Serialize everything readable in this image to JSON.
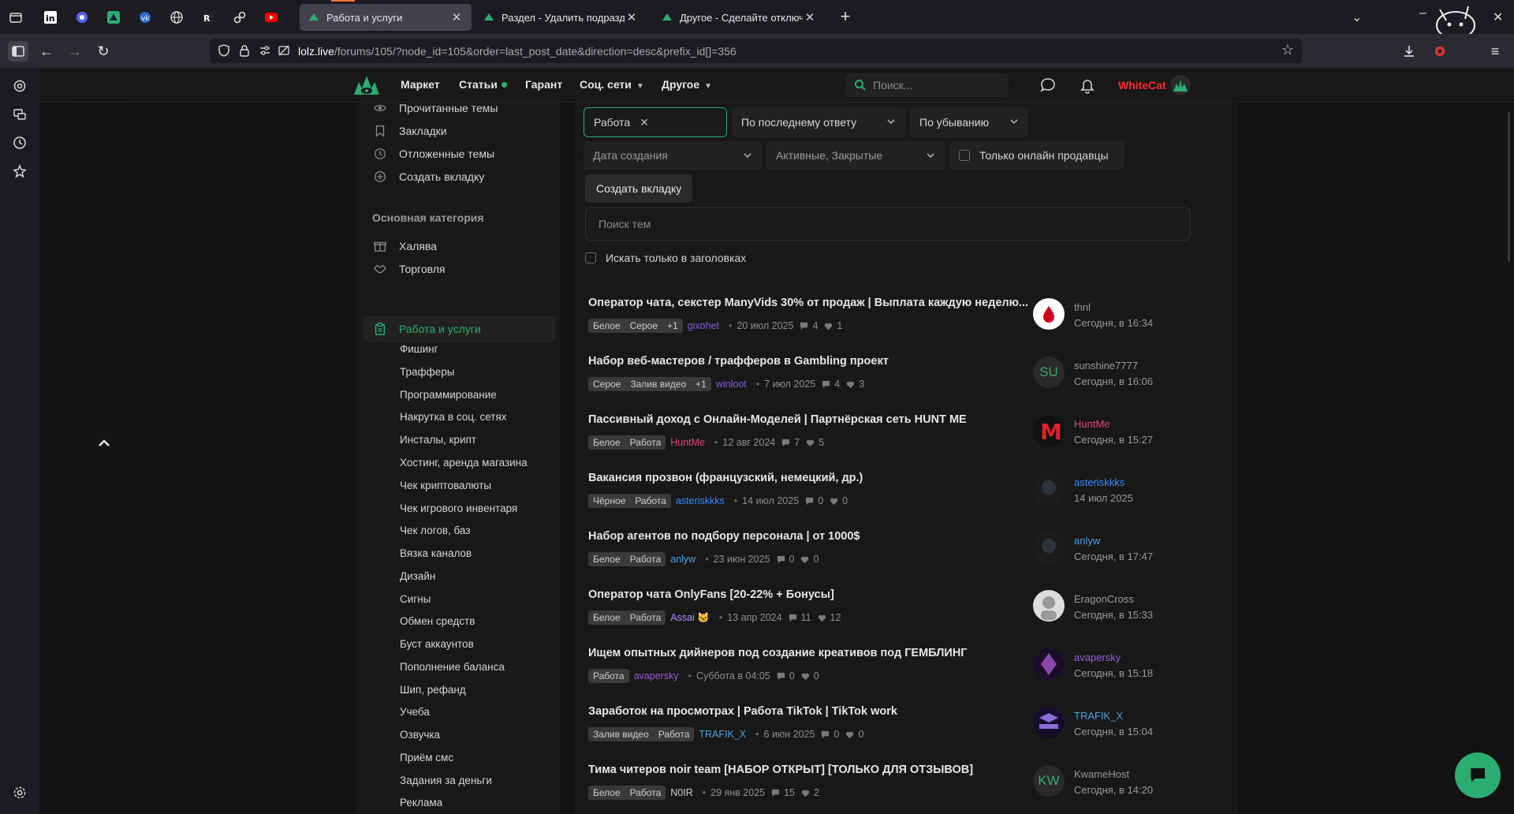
{
  "browser": {
    "tabs": [
      {
        "title": "Работа и услуги",
        "active": true
      },
      {
        "title": "Раздел - Удалить подраздел \"Р",
        "active": false
      },
      {
        "title": "Другое - Сделайте отключени",
        "active": false
      }
    ],
    "url_host": "lolz.live",
    "url_path": "/forums/105/?node_id=105&order=last_post_date&direction=desc&prefix_id[]=356"
  },
  "site": {
    "menu": [
      {
        "label": "Маркет"
      },
      {
        "label": "Статьи"
      },
      {
        "label": "Гарант"
      },
      {
        "label": "Соц. сети"
      },
      {
        "label": "Другое"
      }
    ],
    "search_placeholder": "Поиск...",
    "username": "WhiteCat"
  },
  "sidebar": {
    "top_items": [
      {
        "label": "Прочитанные темы",
        "icon": "eye-icon"
      },
      {
        "label": "Закладки",
        "icon": "bookmark-icon"
      },
      {
        "label": "Отложенные темы",
        "icon": "clock-icon"
      },
      {
        "label": "Создать вкладку",
        "icon": "plus-circle-icon"
      }
    ],
    "category_heading": "Основная категория",
    "categories": [
      {
        "label": "Халява",
        "icon": "gift-icon"
      },
      {
        "label": "Торговля",
        "icon": "handshake-icon"
      },
      {
        "label": "Работа и услуги",
        "icon": "clipboard-icon",
        "active": true
      }
    ],
    "subcategories": [
      "Фишинг",
      "Трафферы",
      "Программирование",
      "Накрутка в соц. сетях",
      "Инсталы, крипт",
      "Хостинг, аренда магазина",
      "Чек криптовалюты",
      "Чек игрового инвентаря",
      "Чек логов, баз",
      "Вязка каналов",
      "Дизайн",
      "Сигны",
      "Обмен средств",
      "Буст аккаунтов",
      "Пополнение баланса",
      "Шип, рефанд",
      "Учеба",
      "Озвучка",
      "Приём смс",
      "Задания за деньги",
      "Реклама"
    ]
  },
  "filters": {
    "prefix": "Работа",
    "order": "По последнему ответу",
    "direction": "По убыванию",
    "date": "Дата создания",
    "state": "Активные, Закрытые",
    "online_only": "Только онлайн продавцы",
    "create_tab": "Создать вкладку",
    "search_placeholder": "Поиск тем",
    "titles_only": "Искать только в заголовках"
  },
  "threads": [
    {
      "title": "Оператор чата, секстер ManyVids 30% от продаж | Выплата каждую неделю...",
      "tags": [
        "Белое",
        "Серое",
        "+1"
      ],
      "author": "gixohet",
      "author_color": "#8a5cd6",
      "date": "20 июл 2025",
      "replies": "4",
      "likes": "1",
      "last_user": "thnl",
      "last_user_color": "#9a9a9a",
      "last_date": "Сегодня, в 16:34",
      "avatar": "drop"
    },
    {
      "title": "Набор веб-мастеров / трафферов в Gambling проект",
      "tags": [
        "Серое",
        "Залив видео",
        "+1"
      ],
      "author": "winloot",
      "author_color": "#8a5cd6",
      "date": "7 июл 2025",
      "replies": "4",
      "likes": "3",
      "last_user": "sunshine7777",
      "last_user_color": "#9a9a9a",
      "last_date": "Сегодня, в 16:06",
      "avatar": "SU"
    },
    {
      "title": "Пассивный доход с Онлайн-Моделей | Партнёрская сеть HUNT ME",
      "tags": [
        "Белое",
        "Работа"
      ],
      "author": "HuntMe",
      "author_color": "#e0457b",
      "date": "12 авг 2024",
      "replies": "7",
      "likes": "5",
      "last_user": "HuntMe",
      "last_user_color": "#e0457b",
      "last_date": "Сегодня, в 15:27",
      "avatar": "M"
    },
    {
      "title": "Вакансия прозвон (французский, немецкий, др.)",
      "tags": [
        "Чёрное",
        "Работа"
      ],
      "author": "asteriskkks",
      "author_color": "#3d8bff",
      "date": "14 июл 2025",
      "replies": "0",
      "likes": "0",
      "last_user": "asteriskkks",
      "last_user_color": "#3d8bff",
      "last_date": "14 июл 2025",
      "avatar": "dark"
    },
    {
      "title": "Набор агентов по подбору персонала | от 1000$",
      "tags": [
        "Белое",
        "Работа"
      ],
      "author": "anlyw",
      "author_color": "#4aa3df",
      "date": "23 июн 2025",
      "replies": "0",
      "likes": "0",
      "last_user": "anlyw",
      "last_user_color": "#4aa3df",
      "last_date": "Сегодня, в 17:47",
      "avatar": "dark"
    },
    {
      "title": "Оператор чата OnlyFans [20-22% + Бонусы]",
      "tags": [
        "Белое",
        "Работа"
      ],
      "author": "Assai 🐱",
      "author_color": "#b48cff",
      "date": "13 апр 2024",
      "replies": "11",
      "likes": "12",
      "last_user": "EragonCross",
      "last_user_color": "#9a9a9a",
      "last_date": "Сегодня, в 15:33",
      "avatar": "light"
    },
    {
      "title": "Ищем опытных дийнеров под создание креативов под ГЕМБЛИНГ",
      "tags": [
        "Работа"
      ],
      "author": "avapersky",
      "author_color": "#9b59d6",
      "date": "Суббота в 04:05",
      "replies": "0",
      "likes": "0",
      "last_user": "avapersky",
      "last_user_color": "#9b59d6",
      "last_date": "Сегодня, в 15:18",
      "avatar": "purple"
    },
    {
      "title": "Заработок на просмотрах | Работа TikTok | TikTok work",
      "tags": [
        "Залив видео",
        "Работа"
      ],
      "author": "TRAFIK_X",
      "author_color": "#4aa3df",
      "date": "6 июн 2025",
      "replies": "0",
      "likes": "0",
      "last_user": "TRAFIK_X",
      "last_user_color": "#4aa3df",
      "last_date": "Сегодня, в 15:04",
      "avatar": "trafik"
    },
    {
      "title": "Тима читеров noir team [НАБОР ОТКРЫТ] [ТОЛЬКО ДЛЯ ОТЗЫВОВ]",
      "tags": [
        "Белое",
        "Работа"
      ],
      "author": "N0IR",
      "author_color": "#cfcfcf",
      "date": "29 янв 2025",
      "replies": "15",
      "likes": "2",
      "last_user": "KwameHost",
      "last_user_color": "#9a9a9a",
      "last_date": "Сегодня, в 14:20",
      "avatar": "KW"
    }
  ]
}
